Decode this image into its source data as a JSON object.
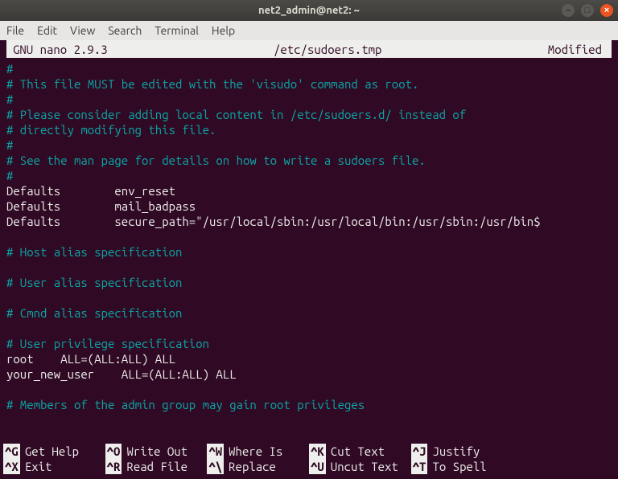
{
  "window": {
    "title": "net2_admin@net2: ~"
  },
  "menubar": [
    "File",
    "Edit",
    "View",
    "Search",
    "Terminal",
    "Help"
  ],
  "nano_header": {
    "left": "GNU nano 2.9.3",
    "center": "/etc/sudoers.tmp",
    "right": "Modified"
  },
  "lines": [
    {
      "cls": "c-comment",
      "text": "#"
    },
    {
      "cls": "c-comment",
      "text": "# This file MUST be edited with the 'visudo' command as root."
    },
    {
      "cls": "c-comment",
      "text": "#"
    },
    {
      "cls": "c-comment",
      "text": "# Please consider adding local content in /etc/sudoers.d/ instead of"
    },
    {
      "cls": "c-comment",
      "text": "# directly modifying this file."
    },
    {
      "cls": "c-comment",
      "text": "#"
    },
    {
      "cls": "c-comment",
      "text": "# See the man page for details on how to write a sudoers file."
    },
    {
      "cls": "c-comment",
      "text": "#"
    },
    {
      "cls": "c-default",
      "text": "Defaults        env_reset"
    },
    {
      "cls": "c-default",
      "text": "Defaults        mail_badpass"
    },
    {
      "cls": "c-default",
      "text": "Defaults        secure_path=\"/usr/local/sbin:/usr/local/bin:/usr/sbin:/usr/bin$"
    },
    {
      "cls": "c-default",
      "text": ""
    },
    {
      "cls": "c-comment",
      "text": "# Host alias specification"
    },
    {
      "cls": "c-default",
      "text": ""
    },
    {
      "cls": "c-comment",
      "text": "# User alias specification"
    },
    {
      "cls": "c-default",
      "text": ""
    },
    {
      "cls": "c-comment",
      "text": "# Cmnd alias specification"
    },
    {
      "cls": "c-default",
      "text": ""
    },
    {
      "cls": "c-comment",
      "text": "# User privilege specification"
    },
    {
      "cls": "c-default",
      "text": "root    ALL=(ALL:ALL) ALL"
    },
    {
      "cls": "c-default",
      "text": "your_new_user    ALL=(ALL:ALL) ALL"
    },
    {
      "cls": "c-default",
      "text": ""
    },
    {
      "cls": "c-comment",
      "text": "# Members of the admin group may gain root privileges"
    }
  ],
  "shortcuts": [
    {
      "key": "^G",
      "label": "Get Help"
    },
    {
      "key": "^O",
      "label": "Write Out"
    },
    {
      "key": "^W",
      "label": "Where Is"
    },
    {
      "key": "^K",
      "label": "Cut Text"
    },
    {
      "key": "^J",
      "label": "Justify"
    },
    {
      "key": "",
      "label": ""
    },
    {
      "key": "^X",
      "label": "Exit"
    },
    {
      "key": "^R",
      "label": "Read File"
    },
    {
      "key": "^\\",
      "label": "Replace"
    },
    {
      "key": "^U",
      "label": "Uncut Text"
    },
    {
      "key": "^T",
      "label": "To Spell"
    },
    {
      "key": "",
      "label": ""
    }
  ]
}
